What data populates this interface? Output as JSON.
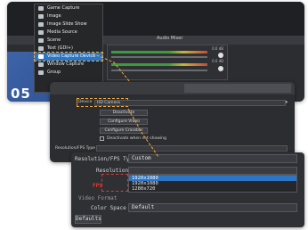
{
  "step_badge": "05",
  "menu": {
    "items": [
      {
        "label": "Game Capture",
        "icon": "gamepad-icon"
      },
      {
        "label": "Image",
        "icon": "image-icon"
      },
      {
        "label": "Image Slide Show",
        "icon": "slideshow-icon"
      },
      {
        "label": "Media Source",
        "icon": "play-icon"
      },
      {
        "label": "Scene",
        "icon": "scene-icon"
      },
      {
        "label": "Text (GDI+)",
        "icon": "text-icon"
      },
      {
        "label": "Video Capture Device",
        "icon": "camera-icon"
      },
      {
        "label": "Window Capture",
        "icon": "window-icon"
      },
      {
        "label": "Group",
        "icon": "folder-icon"
      }
    ],
    "selected_index": 6
  },
  "audio_mixer": {
    "title": "Audio Mixer",
    "channel_1_db": "0.0 dB",
    "channel_2_db": "0.0 dB"
  },
  "properties": {
    "device_label": "Device",
    "device_value": "HD Camera",
    "buttons": [
      "Deactivate",
      "Configure Video",
      "Configure Crossbar"
    ],
    "checkbox_label": "Deactivate when not showing",
    "resolution_label": "Resolution/FPS Type",
    "resolution_value": "Device Default"
  },
  "resolution_panel": {
    "type_label": "Resolution/FPS Type",
    "type_value": "Custom",
    "resolution_label": "Resolution",
    "options": [
      "1920x1080",
      "1920x1080",
      "1280x720"
    ],
    "selected_option": 0,
    "fps_label": "FPS",
    "video_format_label": "Video Format",
    "color_space_label": "Color Space",
    "color_space_value": "Default",
    "defaults_button": "Defaults"
  },
  "colors": {
    "highlight_orange": "#f2a93b",
    "highlight_red": "#e03b2c",
    "selection_blue": "#2b77c6"
  }
}
